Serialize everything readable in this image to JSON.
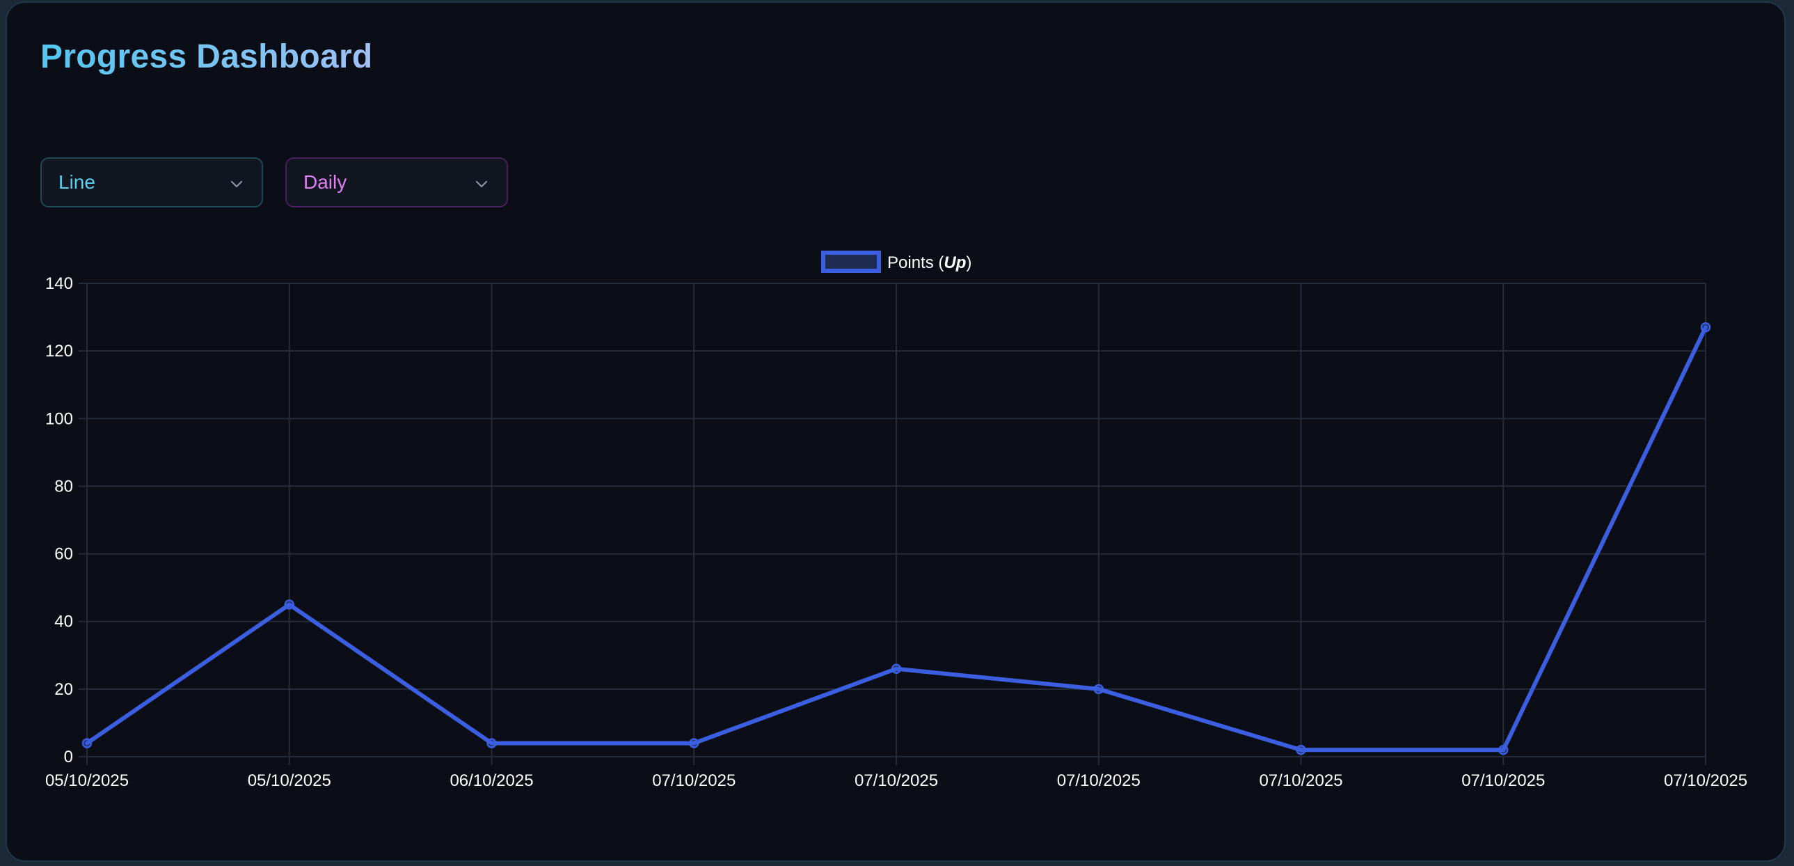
{
  "title": "Progress Dashboard",
  "controls": {
    "chart_type": {
      "value": "Line",
      "icon": "chevron-down-icon"
    },
    "range": {
      "value": "Daily",
      "icon": "chevron-down-icon"
    }
  },
  "colors": {
    "line": "#3b5fe0",
    "grid": "#262b3a",
    "text": "#ffffff",
    "title_start": "#52c7f0",
    "title_end": "#a1bff5"
  },
  "chart_data": {
    "type": "line",
    "legend": {
      "label": "Points (",
      "label_em": "Up",
      "label_end": ")",
      "position": "top-center"
    },
    "x": [
      "05/10/2025",
      "05/10/2025",
      "06/10/2025",
      "07/10/2025",
      "07/10/2025",
      "07/10/2025",
      "07/10/2025",
      "07/10/2025",
      "07/10/2025"
    ],
    "series": [
      {
        "name": "Points (Up)",
        "values": [
          4,
          45,
          4,
          4,
          26,
          20,
          2,
          2,
          127
        ]
      }
    ],
    "ylim": [
      0,
      140
    ],
    "yticks": [
      0,
      20,
      40,
      60,
      80,
      100,
      120,
      140
    ],
    "grid": true
  }
}
